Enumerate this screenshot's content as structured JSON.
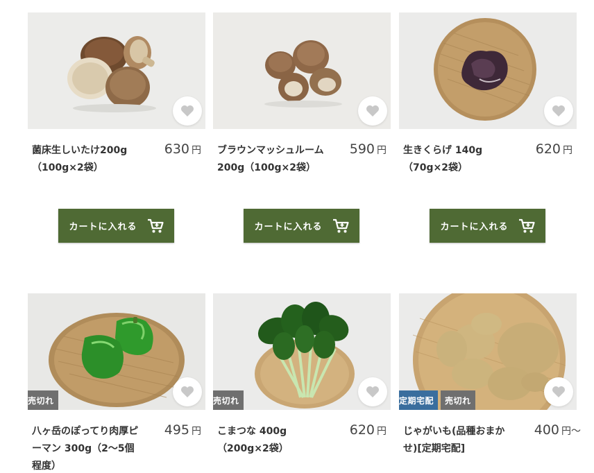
{
  "products": [
    {
      "name": "菌床生しいたけ200g（100g×2袋）",
      "price": "630",
      "yen": "円",
      "cart_label": "カートに入れる"
    },
    {
      "name": "ブラウンマッシュルーム 200g（100g×2袋）",
      "price": "590",
      "yen": "円",
      "cart_label": "カートに入れる"
    },
    {
      "name": "生きくらげ 140g（70g×2袋）",
      "price": "620",
      "yen": "円",
      "cart_label": "カートに入れる"
    },
    {
      "name": "八ヶ岳のぽってり肉厚ピーマン 300g（2〜5個程度）",
      "price": "495",
      "yen": "円",
      "badges": [
        "売切れ"
      ]
    },
    {
      "name": "こまつな 400g（200g×2袋）",
      "price": "620",
      "yen": "円",
      "badges": [
        "売切れ"
      ]
    },
    {
      "name": "じゃがいも(品種おまかせ)[定期宅配]",
      "price": "400",
      "yen": "円",
      "price_suffix": "〜",
      "badges": [
        "定期宅配",
        "売切れ"
      ]
    }
  ],
  "icons": {
    "favorite": "heart-icon",
    "cart": "shopping-cart-icon"
  },
  "colors": {
    "cart_button": "#4f6a34",
    "soldout_badge": "#6f6f6f",
    "regular_delivery_badge": "#3a6e9e",
    "favorite_heart": "#c8c8c8"
  }
}
